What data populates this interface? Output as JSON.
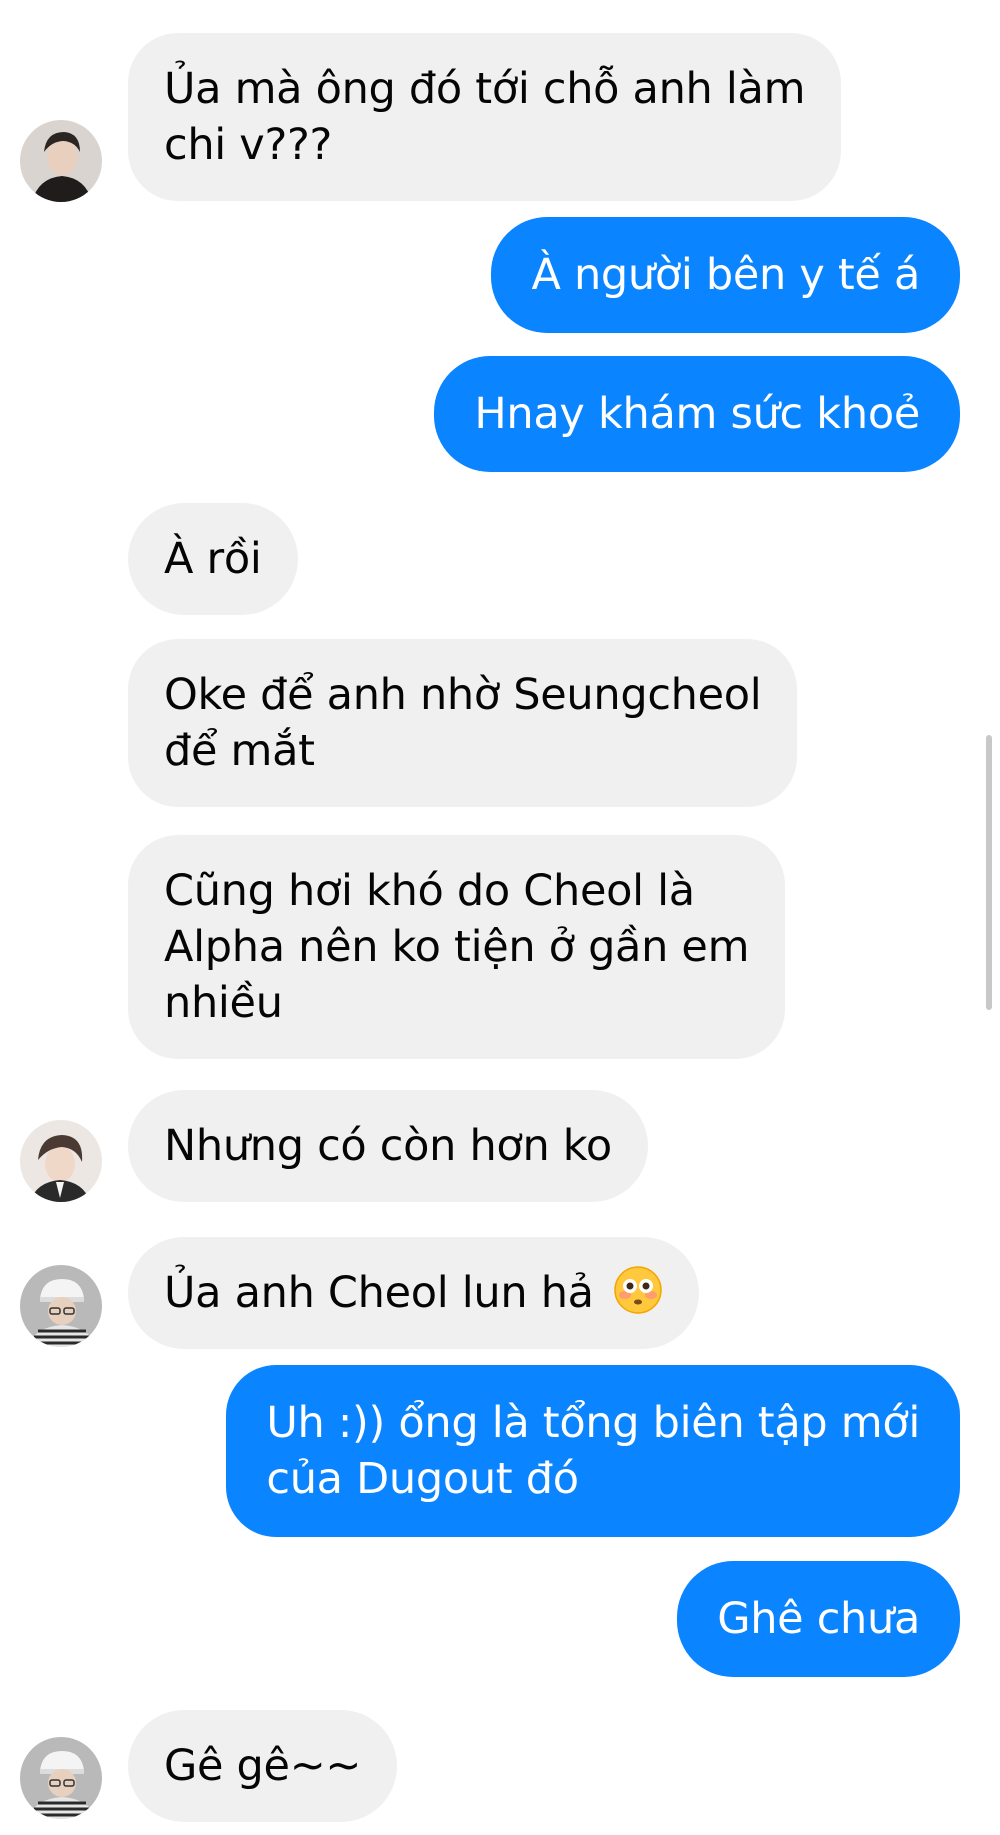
{
  "messages": [
    {
      "dir": "received",
      "text": "Ủa mà ông đó tới chỗ anh làm\nchi v???"
    },
    {
      "dir": "sent",
      "text": "À người bên y tế á"
    },
    {
      "dir": "sent",
      "text": "Hnay khám sức khoẻ"
    },
    {
      "dir": "received",
      "text": "À rồi"
    },
    {
      "dir": "received",
      "text": "Oke để anh nhờ Seungcheol\nđể mắt"
    },
    {
      "dir": "received",
      "text": "Cũng hơi khó do Cheol là\nAlpha nên ko tiện ở gần em\nnhiều"
    },
    {
      "dir": "received",
      "text": "Nhưng có còn hơn ko"
    },
    {
      "dir": "received",
      "text": "Ủa anh Cheol lun hả",
      "emoji": "flushed-face"
    },
    {
      "dir": "sent",
      "text": "Uh :)) ổng là tổng biên tập mới\ncủa Dugout đó"
    },
    {
      "dir": "sent",
      "text": "Ghê chưa"
    },
    {
      "dir": "received",
      "text": "Gê gê~~"
    }
  ],
  "colors": {
    "sent_bubble": "#0a84ff",
    "received_bubble": "#f0f0f0",
    "received_text": "#050505",
    "sent_text": "#ffffff"
  }
}
